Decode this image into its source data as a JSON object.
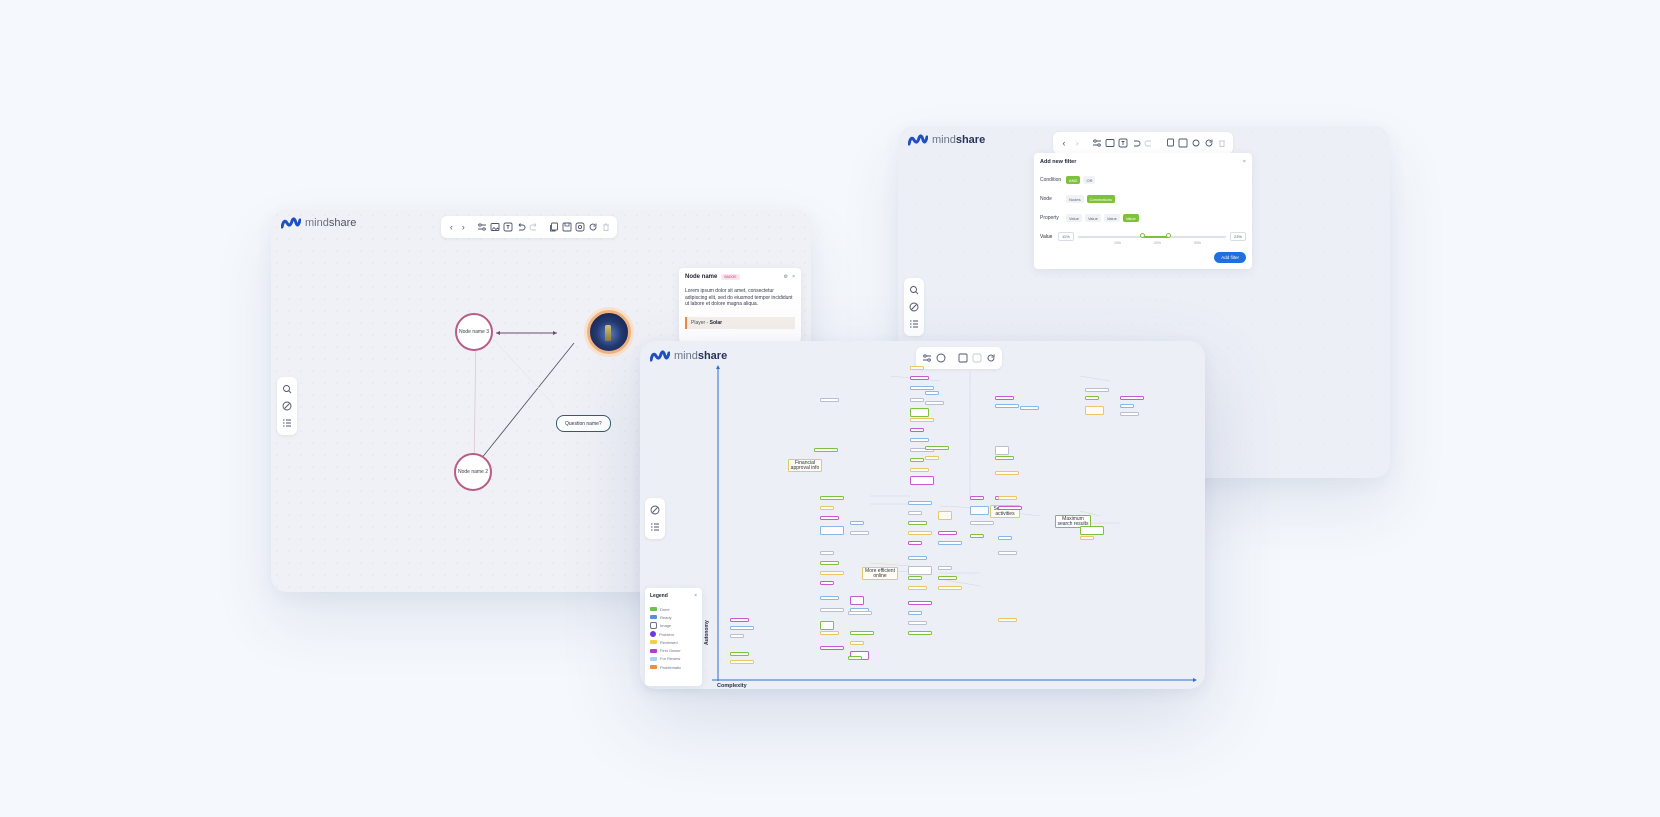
{
  "brand": {
    "part_a": "mind",
    "part_b": "share",
    "color": "#1f4fc1"
  },
  "window_a": {
    "nodes": {
      "n3": "Node name 3",
      "n2": "Node name 2",
      "question": "Question name?"
    },
    "node_panel": {
      "title": "Node name",
      "badge": "BADGE",
      "description": "Lorem ipsum dolor sit amet, consectetur adipiscing elit, sed do eiusmod tempor incididunt ut labore et dolore magna aliqua.",
      "player_label": "Player - ",
      "player_value": "Solar"
    }
  },
  "filter_panel": {
    "title": "Add new filter",
    "close": "×",
    "condition_label": "Condition",
    "conditions": [
      "AND",
      "OR"
    ],
    "node_label": "Node",
    "node_options": [
      "Nodes",
      "Connections"
    ],
    "property_label": "Property",
    "property_options": [
      "Value",
      "Value",
      "Value",
      "Value"
    ],
    "value_label": "Value",
    "value_min": "11%",
    "value_max": "23%",
    "slider": {
      "start": 0.44,
      "end": 0.61
    },
    "ticks": [
      "10%",
      "20%",
      "30%"
    ],
    "button": "Add filter"
  },
  "legend": {
    "title": "Legend",
    "close": "×",
    "items": [
      {
        "label": "Done",
        "color": "#6cc24a",
        "shape": "rect"
      },
      {
        "label": "Ready",
        "color": "#5a8de0",
        "shape": "rect"
      },
      {
        "label": "Image",
        "color": "#6b7386",
        "shape": "outline"
      },
      {
        "label": "Problem",
        "color": "#6c3be0",
        "shape": "circle"
      },
      {
        "label": "Reviewed",
        "color": "#f2cf45",
        "shape": "rect"
      },
      {
        "label": "First Owner",
        "color": "#b43be0",
        "shape": "rect"
      },
      {
        "label": "For Review",
        "color": "#a7d3f7",
        "shape": "rect"
      },
      {
        "label": "Problematic",
        "color": "#f08f3a",
        "shape": "rect"
      }
    ]
  },
  "matrix": {
    "y_axis": "Autonomy",
    "x_axis": "Complexity",
    "labels": {
      "financial": "Financial approval info",
      "search": "Search for activities",
      "efficient": "More efficient online browsing",
      "maximum": "Maximum search results is 300"
    }
  }
}
